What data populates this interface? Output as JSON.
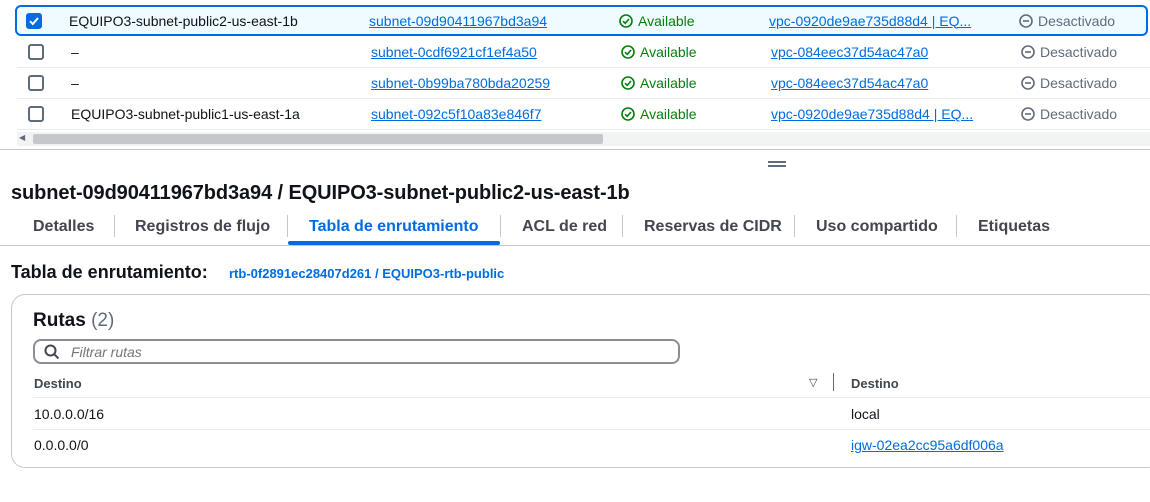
{
  "subnets": [
    {
      "name": "EQUIPO3-subnet-public2-us-east-1b",
      "subnet_id": "subnet-09d90411967bd3a94",
      "state": "Available",
      "vpc": "vpc-0920de9ae735d88d4 | EQ...",
      "block": "Desactivado",
      "selected": true
    },
    {
      "name": "–",
      "subnet_id": "subnet-0cdf6921cf1ef4a50",
      "state": "Available",
      "vpc": "vpc-084eec37d54ac47a0",
      "block": "Desactivado",
      "selected": false
    },
    {
      "name": "–",
      "subnet_id": "subnet-0b99ba780bda20259",
      "state": "Available",
      "vpc": "vpc-084eec37d54ac47a0",
      "block": "Desactivado",
      "selected": false
    },
    {
      "name": "EQUIPO3-subnet-public1-us-east-1a",
      "subnet_id": "subnet-092c5f10a83e846f7",
      "state": "Available",
      "vpc": "vpc-0920de9ae735d88d4 | EQ...",
      "block": "Desactivado",
      "selected": false
    }
  ],
  "detail": {
    "title": "subnet-09d90411967bd3a94 / EQUIPO3-subnet-public2-us-east-1b"
  },
  "tabs": [
    {
      "label": "Detalles",
      "active": false
    },
    {
      "label": "Registros de flujo",
      "active": false
    },
    {
      "label": "Tabla de enrutamiento",
      "active": true
    },
    {
      "label": "ACL de red",
      "active": false
    },
    {
      "label": "Reservas de CIDR",
      "active": false
    },
    {
      "label": "Uso compartido",
      "active": false
    },
    {
      "label": "Etiquetas",
      "active": false
    }
  ],
  "route_table": {
    "heading": "Tabla de enrutamiento:",
    "link": "rtb-0f2891ec28407d261 / EQUIPO3-rtb-public"
  },
  "routes": {
    "title": "Rutas",
    "count": "(2)",
    "filter_placeholder": "Filtrar rutas",
    "columns": [
      "Destino",
      "Destino"
    ],
    "rows": [
      {
        "destination": "10.0.0.0/16",
        "target": "local",
        "target_is_link": false
      },
      {
        "destination": "0.0.0.0/0",
        "target": "igw-02ea2cc95a6df006a",
        "target_is_link": true
      }
    ]
  },
  "colors": {
    "accent": "#006ce0",
    "success": "#037f0c",
    "muted": "#5f6b7a"
  },
  "icons": {
    "checkbox_checked": "checkmark-icon",
    "status_available": "check-circle-icon",
    "status_disabled": "minus-circle-icon",
    "search": "search-icon",
    "sort": "sort-down-icon"
  }
}
